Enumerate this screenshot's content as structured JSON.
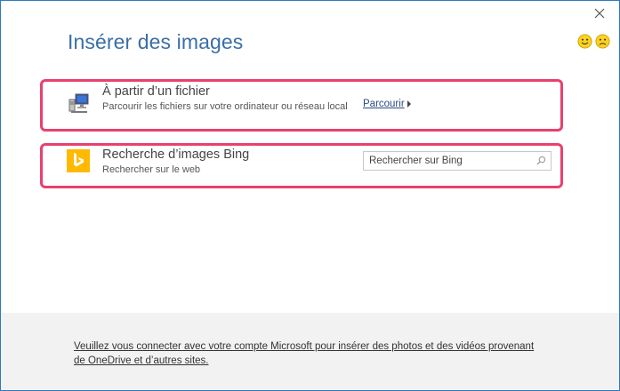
{
  "dialog": {
    "title": "Insérer des images"
  },
  "file_section": {
    "title": "À partir d’un fichier",
    "description": "Parcourir les fichiers sur votre ordinateur ou réseau local",
    "browse_label": "Parcourir",
    "icon": "computer-network-icon"
  },
  "bing_section": {
    "title": "Recherche d’images Bing",
    "description": "Rechercher sur le web",
    "search_placeholder": "Rechercher sur Bing",
    "icon": "bing-logo-icon"
  },
  "footer": {
    "signin_text": "Veuillez vous connecter avec votre compte Microsoft pour insérer des photos et des vidéos provenant de OneDrive et d’autres sites."
  },
  "colors": {
    "title": "#3a6fa5",
    "highlight_border": "#e8406f",
    "bing_brand": "#ffb900",
    "window_border": "#2b79c2",
    "footer_bg": "#f2f2f2"
  }
}
